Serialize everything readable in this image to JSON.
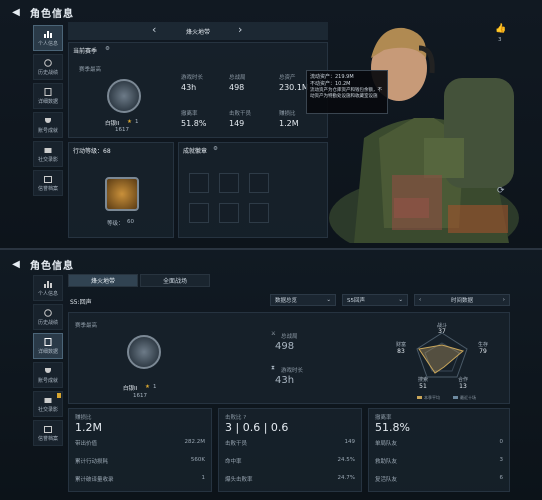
{
  "top": {
    "title": "角色信息",
    "sidebar": [
      "个人信息",
      "历史战绩",
      "详细数据",
      "账号成就",
      "社交录影",
      "信誉档案"
    ],
    "season_header": "烽火地带",
    "current_season": "当前赛季",
    "season_best": "赛季最高",
    "rank_name": "白银II",
    "rank_stars": "1",
    "rank_points": "1617",
    "stats": [
      {
        "label": "游戏时长",
        "value": "43h"
      },
      {
        "label": "总战局",
        "value": "498"
      },
      {
        "label": "总资产",
        "value": "230.1M"
      },
      {
        "label": "撤离率",
        "value": "51.8%"
      },
      {
        "label": "击败干员",
        "value": "149"
      },
      {
        "label": "赚损比",
        "value": "1.2M"
      }
    ],
    "action_level": "行动等级：68",
    "level_label": "等级：",
    "level_value": "60",
    "achievements": "成就徽章",
    "tooltip": [
      "流动资产：219.9M",
      "不动资产：10.2M",
      "流动资产为仓库资产和钱包余额，不动资产为特勤处设施和收藏室设施"
    ],
    "likes": "3"
  },
  "bottom": {
    "title": "角色信息",
    "sidebar": [
      "个人信息",
      "历史战绩",
      "详细数据",
      "账号成就",
      "社交录影",
      "信誉档案"
    ],
    "tabs": [
      "烽火地带",
      "全面战场"
    ],
    "season": "S5:回声",
    "dropdowns": [
      "数据总览",
      "S5回声"
    ],
    "date_filter": "时间数据",
    "season_best": "赛季最高",
    "rank_name": "白银II",
    "rank_stars": "1",
    "rank_points": "1617",
    "total_label": "总战局",
    "total_value": "498",
    "time_label": "游戏时长",
    "time_value": "43h",
    "radar": {
      "labels": [
        "战斗",
        "生存",
        "合作",
        "搜索",
        "财富"
      ],
      "values": [
        "37",
        "79",
        "13",
        "51",
        "83"
      ],
      "legend": [
        "本季平均",
        "最近十场"
      ]
    },
    "cards": [
      {
        "label": "赚损比",
        "value": "1.2M",
        "rows": [
          [
            "带出价值",
            "282.2M"
          ],
          [
            "累计行动损耗",
            "560K"
          ],
          [
            "累计破译量收录",
            "1"
          ]
        ]
      },
      {
        "label": "击败比 ?",
        "value": "3 | 0.6 | 0.6",
        "rows": [
          [
            "击败干员",
            "149"
          ],
          [
            "命中率",
            "24.5%"
          ],
          [
            "爆头击败率",
            "24.7%"
          ]
        ]
      },
      {
        "label": "撤离率",
        "value": "51.8%",
        "rows": [
          [
            "单局队友",
            "0"
          ],
          [
            "救助队友",
            "3"
          ],
          [
            "复活队友",
            "6"
          ]
        ]
      }
    ]
  },
  "colors": {
    "accent": "#d8a630",
    "panel": "#18222c",
    "bg": "#0c1218"
  }
}
